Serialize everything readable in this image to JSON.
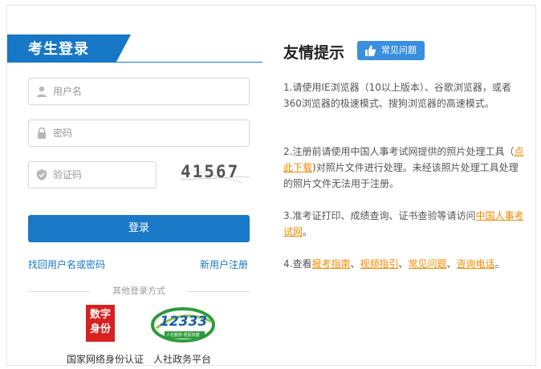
{
  "login": {
    "title": "考生登录",
    "username_placeholder": "用户名",
    "password_placeholder": "密码",
    "captcha_placeholder": "验证码",
    "captcha_text": "41567",
    "login_button": "登录",
    "forgot_link": "找回用户名或密码",
    "register_link": "新用户注册",
    "other_methods": "其他登录方式",
    "logo1_line1": "数字",
    "logo1_line2": "身份",
    "logo1_caption": "国家网络身份认证",
    "logo2_number": "12333",
    "logo2_small": "人社服务·便民快捷",
    "logo2_caption": "人社政务平台"
  },
  "tips": {
    "title": "友情提示",
    "faq_badge": "常见问题",
    "item1": "1.请使用IE浏览器（10以上版本）、谷歌浏览器，或者360浏览器的极速模式、搜狗浏览器的高速模式。",
    "item2_pre": "2.注册前请使用中国人事考试网提供的照片处理工具（",
    "item2_link": "点此下载",
    "item2_post": ")对照片文件进行处理。未经该照片处理工具处理的照片文件无法用于注册。",
    "item3_pre": "3.准考证打印、成绩查询、证书查验等请访问",
    "item3_link": "中国人事考试网",
    "item3_post": "。",
    "item4_pre": "4.查看",
    "item4_link1": "报考指南",
    "item4_sep1": "、",
    "item4_link2": "视频指引",
    "item4_sep2": "、",
    "item4_link3": "常见问题",
    "item4_sep3": "、",
    "item4_link4": "咨询电话",
    "item4_post": "。"
  },
  "colors": {
    "primary": "#1677c7",
    "link_orange": "#f08a00",
    "badge_blue": "#3b8fe0",
    "logo_red": "#d8201f"
  }
}
